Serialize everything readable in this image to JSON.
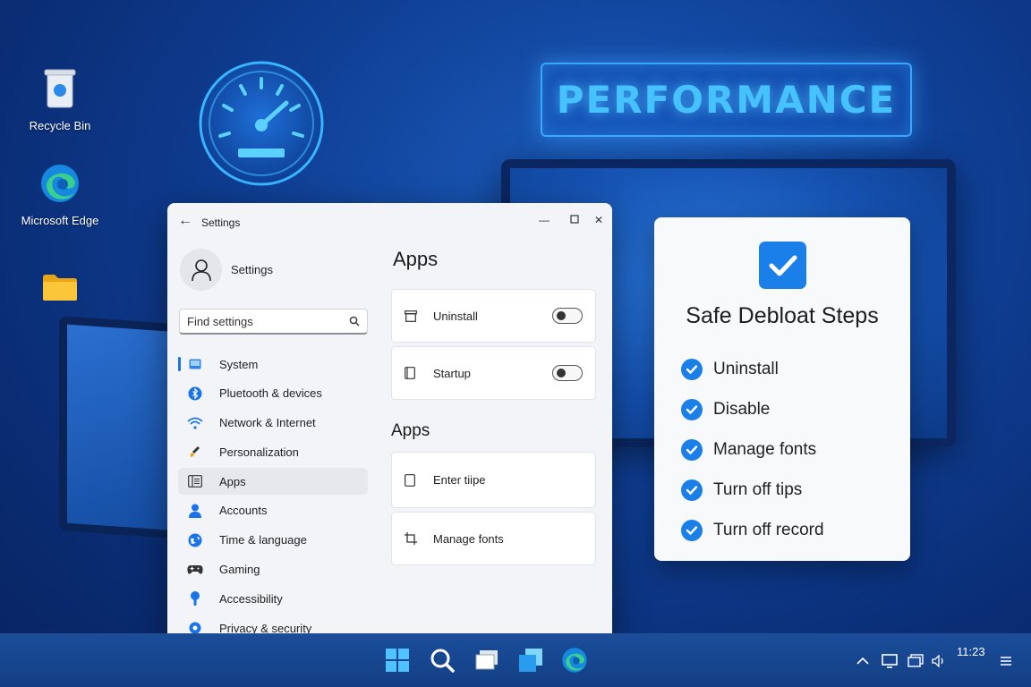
{
  "desktop": {
    "icons": [
      {
        "label": "Recycle Bin",
        "icon": "recycle-bin-icon"
      },
      {
        "label": "Microsoft Edge",
        "icon": "edge-icon"
      },
      {
        "label": "",
        "icon": "folder-icon"
      }
    ],
    "banner": "PERFORMANCE"
  },
  "settings": {
    "title": "Settings",
    "profile_name": "Settings",
    "search_placeholder": "Find settings",
    "nav": [
      {
        "label": "System",
        "icon": "system-icon"
      },
      {
        "label": "Pluetooth & devices",
        "icon": "bluetooth-icon"
      },
      {
        "label": "Network & Internet",
        "icon": "wifi-icon"
      },
      {
        "label": "Personalization",
        "icon": "brush-icon"
      },
      {
        "label": "Apps",
        "icon": "apps-icon"
      },
      {
        "label": "Accounts",
        "icon": "account-icon"
      },
      {
        "label": "Time & language",
        "icon": "globe-icon"
      },
      {
        "label": "Gaming",
        "icon": "gamepad-icon"
      },
      {
        "label": "Accessibility",
        "icon": "accessibility-icon"
      },
      {
        "label": "Privacy & security",
        "icon": "shield-icon"
      }
    ],
    "active_nav": "Apps",
    "heading": "Apps",
    "toggles": [
      {
        "label": "Uninstall",
        "on": false
      },
      {
        "label": "Startup",
        "on": false
      }
    ],
    "subheading": "Apps",
    "rows": [
      {
        "label": "Enter tiipe"
      },
      {
        "label": "Manage fonts"
      }
    ]
  },
  "steps_card": {
    "title": "Safe Debloat Steps",
    "items": [
      "Uninstall",
      "Disable",
      "Manage fonts",
      "Turn off tips",
      "Turn off record"
    ],
    "accent": "#1a7fe8"
  },
  "taskbar": {
    "apps": [
      "start-icon",
      "search-icon",
      "task-view-icon",
      "widgets-icon",
      "edge-icon"
    ],
    "clock": "11:23"
  }
}
